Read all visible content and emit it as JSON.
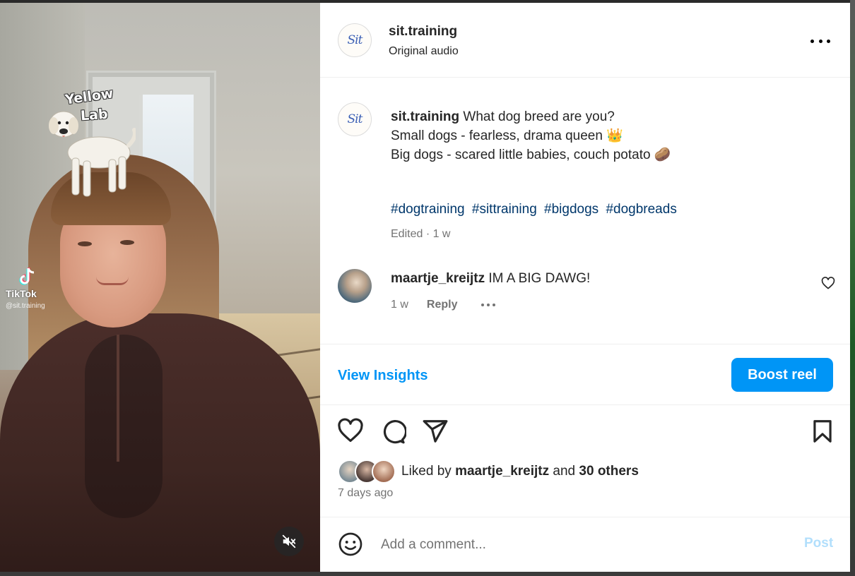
{
  "video": {
    "overlay_text_line1": "Yellow",
    "overlay_text_line2": "Lab",
    "watermark_brand": "TikTok",
    "watermark_handle": "@sit.training"
  },
  "header": {
    "username": "sit.training",
    "audio": "Original audio"
  },
  "caption": {
    "username": "sit.training",
    "line1": "What dog breed are you?",
    "line2": "Small dogs - fearless, drama queen",
    "line2_emoji": "👑",
    "line3": "Big dogs - scared little babies, couch potato",
    "line3_emoji": "🥔",
    "hashtags": [
      "#dogtraining",
      "#sittraining",
      "#bigdogs",
      "#dogbreads"
    ],
    "edited": "Edited · 1 w"
  },
  "comment": {
    "username": "maartje_kreijtz",
    "text": "IM A BIG DAWG!",
    "time": "1 w",
    "reply_label": "Reply"
  },
  "insights": {
    "view_label": "View Insights",
    "boost_label": "Boost reel"
  },
  "likes": {
    "prefix": "Liked by",
    "user": "maartje_kreijtz",
    "conjunction": "and",
    "others": "30 others",
    "time_ago": "7 days ago"
  },
  "comment_box": {
    "placeholder": "Add a comment...",
    "post_label": "Post"
  },
  "colors": {
    "accent": "#0095f6",
    "hashtag": "#00376b",
    "muted": "#737373",
    "post_disabled": "#b2dffc"
  },
  "icons": {
    "more": "more-horizontal-icon",
    "like": "heart-icon",
    "comment": "comment-bubble-icon",
    "share": "paper-plane-icon",
    "save": "bookmark-icon",
    "emoji": "smiley-icon",
    "mute": "speaker-muted-icon"
  }
}
